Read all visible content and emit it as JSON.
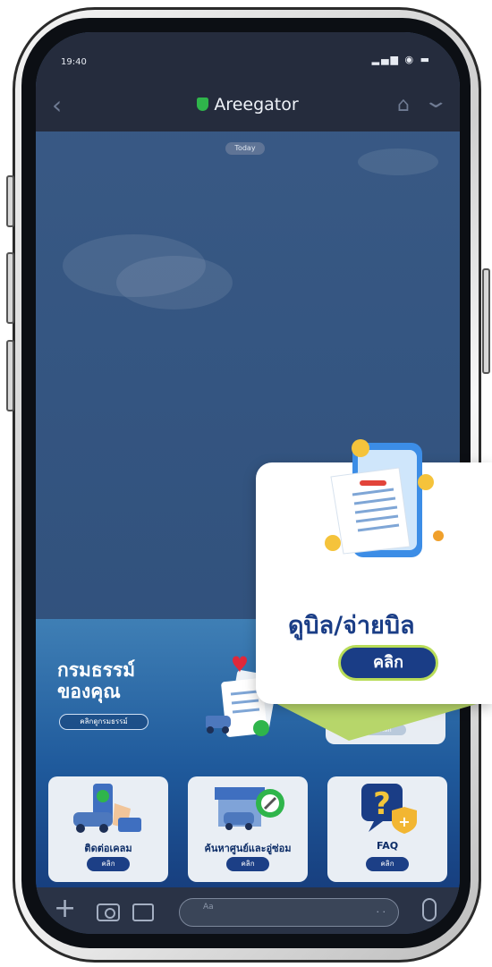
{
  "status": {
    "time": "19:40",
    "icons": "▂▄▆ ◉ ▬"
  },
  "nav": {
    "title": "Areegator",
    "back_icon": "chevron-left-icon",
    "home_icon": "home-icon",
    "menu_icon": "chevron-down-icon"
  },
  "chat": {
    "date_pill": "Today"
  },
  "popup": {
    "title": "ดูบิล/จ่ายบิล",
    "button": "คลิก",
    "accent": "#b8dc58",
    "brand": "#1a3d86"
  },
  "richmenu": {
    "heading_line1": "กรมธรรม์",
    "heading_line2": "ของคุณ",
    "heading_button": "คลิกดูกรมธรรม์",
    "partial_button": "คลิก",
    "cards": [
      {
        "label": "ติดต่อเคลม",
        "button": "คลิก"
      },
      {
        "label": "ค้นหาศูนย์และอู่ซ่อม",
        "button": "คลิก"
      },
      {
        "label": "FAQ",
        "button": "คลิก"
      }
    ]
  },
  "input": {
    "placeholder": "Aa",
    "emoji": "· ·"
  }
}
